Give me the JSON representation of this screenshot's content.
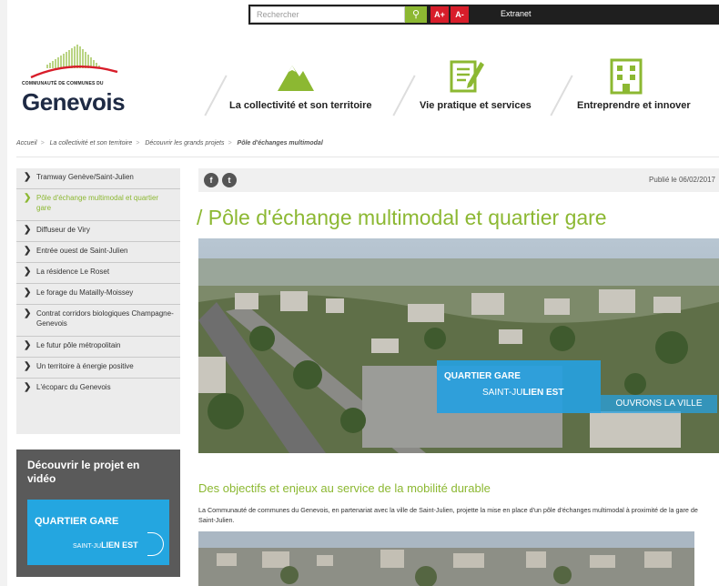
{
  "header": {
    "search_placeholder": "Rechercher",
    "search_button_icon": "search-icon",
    "font_increase": "A+",
    "font_decrease": "A-",
    "extranet": "Extranet"
  },
  "logo": {
    "small": "COMMUNAUTÉ DE COMMUNES DU",
    "big": "Genevois"
  },
  "nav": [
    {
      "label": "La collectivité et son territoire",
      "icon": "mountain-icon"
    },
    {
      "label": "Vie pratique et services",
      "icon": "notepad-pencil-icon"
    },
    {
      "label": "Entreprendre et innover",
      "icon": "building-icon"
    }
  ],
  "breadcrumb": {
    "items": [
      "Accueil",
      "La collectivité et son territoire",
      "Découvrir les grands projets"
    ],
    "current": "Pôle d'échanges multimodal"
  },
  "sidebar": {
    "items": [
      {
        "label": "Tramway Genève/Saint-Julien"
      },
      {
        "label": "Pôle d'échange multimodal et quartier gare"
      },
      {
        "label": "Diffuseur de Viry"
      },
      {
        "label": "Entrée ouest de Saint-Julien"
      },
      {
        "label": "La résidence Le Roset"
      },
      {
        "label": "Le forage du Matailly-Moissey"
      },
      {
        "label": "Contrat corridors biologiques Champagne-Genevois"
      },
      {
        "label": "Le futur pôle métropolitain"
      },
      {
        "label": "Un territoire à énergie positive"
      },
      {
        "label": "L'écoparc du Genevois"
      }
    ],
    "active_index": 1
  },
  "video": {
    "title": "Découvrir le projet en vidéo",
    "thumb_line1": "QUARTIER GARE",
    "thumb_line2a": "SAINT-JU",
    "thumb_line2b": "LIEN EST"
  },
  "article": {
    "social_icons": [
      "facebook-icon",
      "twitter-icon"
    ],
    "published": "Publié le 06/02/2017",
    "title": "/ Pôle d'échange multimodal et quartier gare",
    "banner_line1": "QUARTIER GARE",
    "banner_line2a": "SAINT-JU",
    "banner_line2b": "LIEN EST",
    "banner_line3": "OUVRONS LA VILLE",
    "subtitle": "Des objectifs et enjeux au service de la mobilité durable",
    "paragraph": "La Communauté de communes du Genevois, en partenariat avec la ville de Saint-Julien, projette la mise en place d'un pôle d'échanges multimodal à proximité de la gare de Saint-Julien."
  },
  "colors": {
    "accent_green": "#8cb832",
    "brand_blue": "#24a6e0",
    "alert_red": "#d81d2a"
  }
}
